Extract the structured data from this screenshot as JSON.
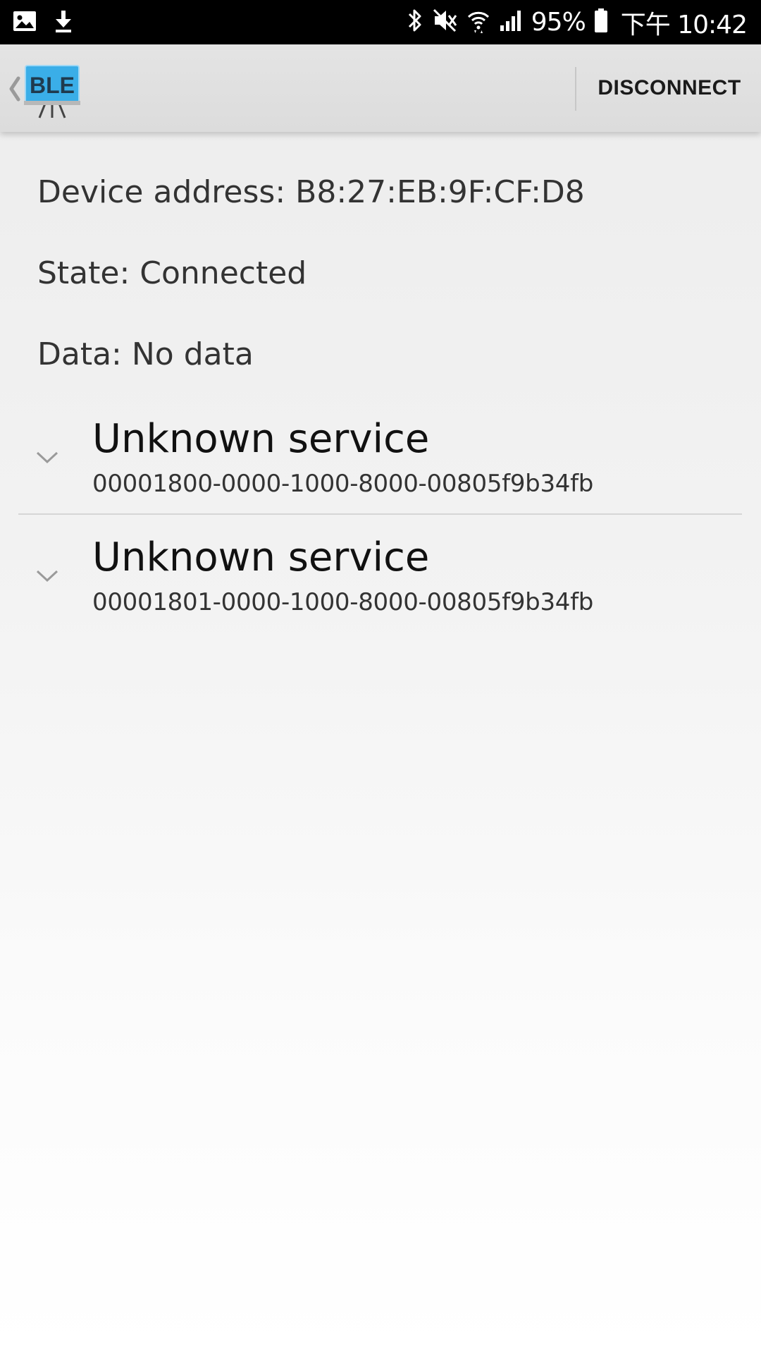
{
  "status_bar": {
    "left_icons": [
      "image-icon",
      "download-icon"
    ],
    "right_icons": [
      "bluetooth-icon",
      "mute-icon",
      "wifi-icon",
      "signal-icon",
      "battery-icon"
    ],
    "battery_percent": "95%",
    "time": "下午 10:42"
  },
  "action_bar": {
    "logo_text": "BLE",
    "disconnect_label": "DISCONNECT",
    "colors": {
      "logo_blue": "#3aaee8",
      "background": "#dddddd"
    }
  },
  "device": {
    "address_line": "Device address: B8:27:EB:9F:CF:D8",
    "state_line": "State: Connected",
    "data_line": "Data: No data"
  },
  "services": [
    {
      "name": "Unknown service",
      "uuid": "00001800-0000-1000-8000-00805f9b34fb"
    },
    {
      "name": "Unknown service",
      "uuid": "00001801-0000-1000-8000-00805f9b34fb"
    }
  ]
}
